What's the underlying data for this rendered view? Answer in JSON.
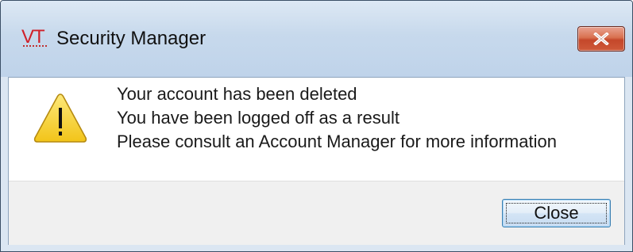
{
  "window": {
    "title": "Security Manager",
    "logo_text": "VT",
    "close_icon": "close-x-icon"
  },
  "message": {
    "icon": "warning-icon",
    "lines": [
      "Your account has been deleted",
      "You have been logged off as a result",
      "Please consult an Account Manager for more information"
    ]
  },
  "buttons": {
    "close_label": "Close"
  },
  "colors": {
    "titlebar": "#c7d9ec",
    "close_button": "#c4472a",
    "warning_fill": "#f7d23b",
    "logo": "#d0202a"
  }
}
